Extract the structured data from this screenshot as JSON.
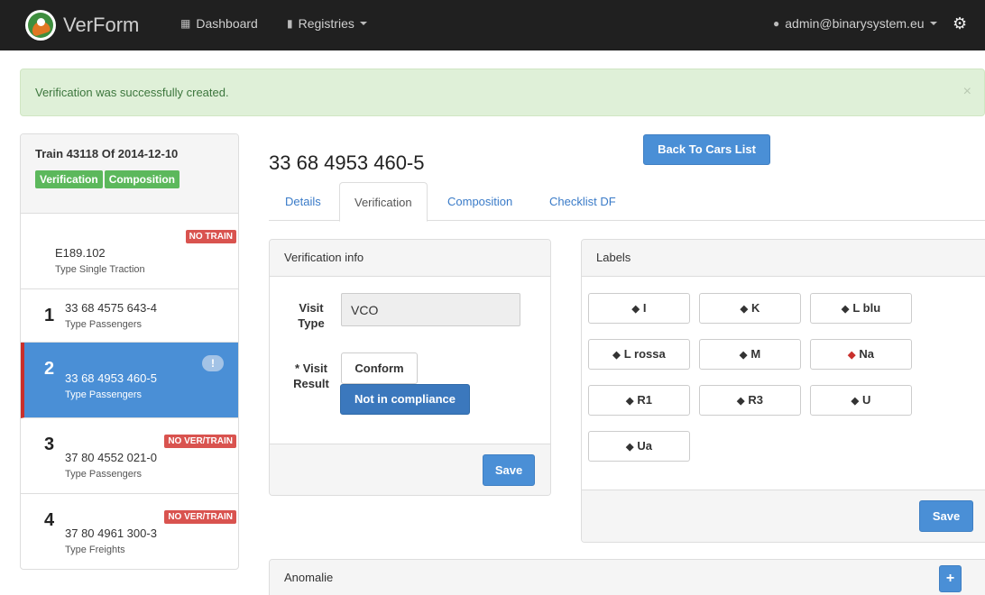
{
  "app": {
    "name": "VerForm"
  },
  "nav": {
    "dashboard": "Dashboard",
    "registries": "Registries",
    "user": "admin@binarysystem.eu",
    "icons": {
      "dashboard": "calendar-icon",
      "registries": "book-icon",
      "user": "user-icon",
      "settings": "gear-icon"
    }
  },
  "alert": {
    "message": "Verification was successfully created.",
    "close": "×"
  },
  "train": {
    "title": "Train 43118 Of 2014-12-10",
    "labels": [
      "Verification",
      "Composition"
    ]
  },
  "cars": [
    {
      "num": "",
      "code": "E189.102",
      "type": "Type Single Traction",
      "badge": "NO TRAIN"
    },
    {
      "num": "1",
      "code": "33 68 4575 643-4",
      "type": "Type Passengers",
      "badge": ""
    },
    {
      "num": "2",
      "code": "33 68 4953 460-5",
      "type": "Type Passengers",
      "badge": "!",
      "active": true
    },
    {
      "num": "3",
      "code": "37 80 4552 021-0",
      "type": "Type Passengers",
      "badge": "NO VER/TRAIN"
    },
    {
      "num": "4",
      "code": "37 80 4961 300-3",
      "type": "Type Freights",
      "badge": "NO VER/TRAIN"
    }
  ],
  "main": {
    "title": "33 68 4953 460-5",
    "back_button": "Back To Cars List",
    "tabs": [
      "Details",
      "Verification",
      "Composition",
      "Checklist DF"
    ],
    "active_tab": "Verification"
  },
  "verification": {
    "heading": "Verification info",
    "visit_type_label": "Visit Type",
    "visit_type_value": "VCO",
    "visit_result_label": "* Visit Result",
    "result_options": [
      "Conform",
      "Not in compliance"
    ],
    "selected_result": "Not in compliance",
    "save": "Save"
  },
  "labels_panel": {
    "heading": "Labels",
    "items": [
      "I",
      "K",
      "L blu",
      "L rossa",
      "M",
      "Na",
      "R1",
      "R3",
      "U",
      "Ua"
    ],
    "highlighted": "Na",
    "save": "Save"
  },
  "anomalie": {
    "heading": "Anomalie",
    "add": "+"
  },
  "colors": {
    "primary": "#4a8fd6",
    "success": "#5cb85c",
    "danger": "#d9534f",
    "navbar": "#202020"
  }
}
